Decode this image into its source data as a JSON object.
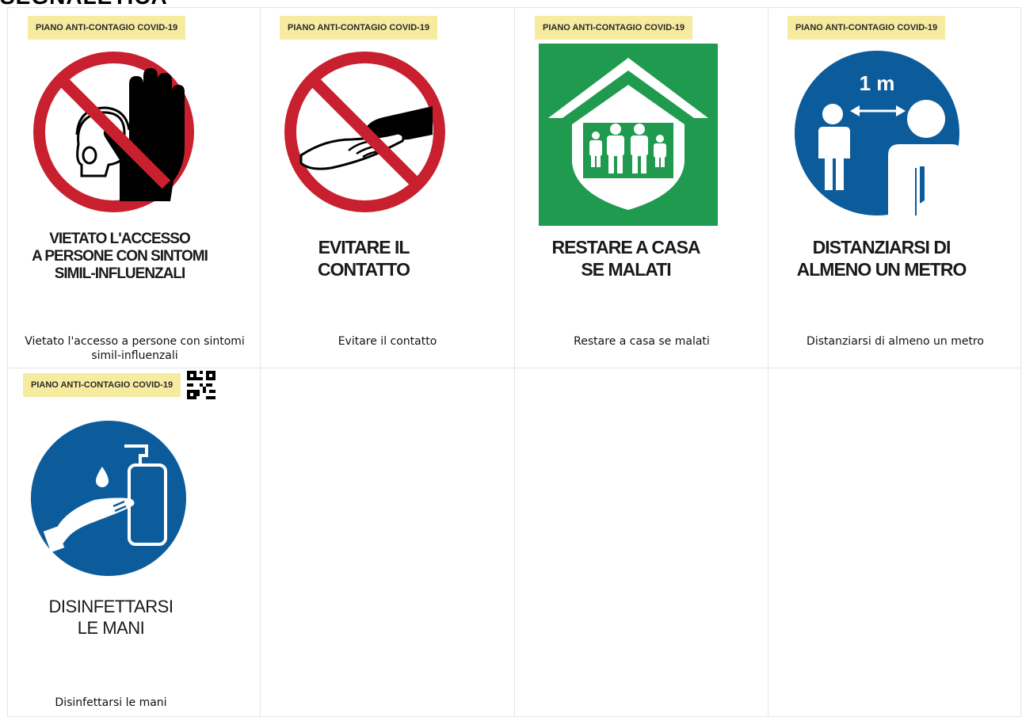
{
  "page": {
    "heading": "SEGNALETICA"
  },
  "signs": [
    {
      "tag": "PIANO ANTI-CONTAGIO COVID-19",
      "icon": "no-entry-hand-icon",
      "sign_text": "VIETATO L'ACCESSO\nA PERSONE CON SINTOMI\nSIMIL-INFLUENZALI",
      "caption": "Vietato l'accesso a persone con sintomi simil-influenzali",
      "colors": {
        "ring": "#c8202e",
        "symbol": "#000000"
      }
    },
    {
      "tag": "PIANO ANTI-CONTAGIO COVID-19",
      "icon": "no-contact-icon",
      "sign_text": "EVITARE IL\nCONTATTO",
      "caption": "Evitare il contatto",
      "colors": {
        "ring": "#c8202e",
        "symbol": "#000000"
      }
    },
    {
      "tag": "PIANO ANTI-CONTAGIO COVID-19",
      "icon": "stay-home-icon",
      "sign_text": "RESTARE A CASA\nSE MALATI",
      "caption": "Restare a casa se malati",
      "colors": {
        "background": "#1f9a4f",
        "symbol": "#ffffff"
      }
    },
    {
      "tag": "PIANO ANTI-CONTAGIO COVID-19",
      "icon": "distance-icon",
      "distance_label": "1 m",
      "sign_text": "DISTANZIARSI DI\nALMENO UN METRO",
      "caption": "Distanziarsi di almeno un metro",
      "colors": {
        "background": "#0c5c9c",
        "symbol": "#ffffff"
      }
    },
    {
      "tag": "PIANO ANTI-CONTAGIO COVID-19",
      "icon": "hand-sanitizer-icon",
      "has_qr": true,
      "sign_text": "DISINFETTARSI\nLE MANI",
      "caption": "Disinfettarsi le mani",
      "colors": {
        "background": "#0c5c9c",
        "symbol": "#ffffff"
      }
    }
  ]
}
